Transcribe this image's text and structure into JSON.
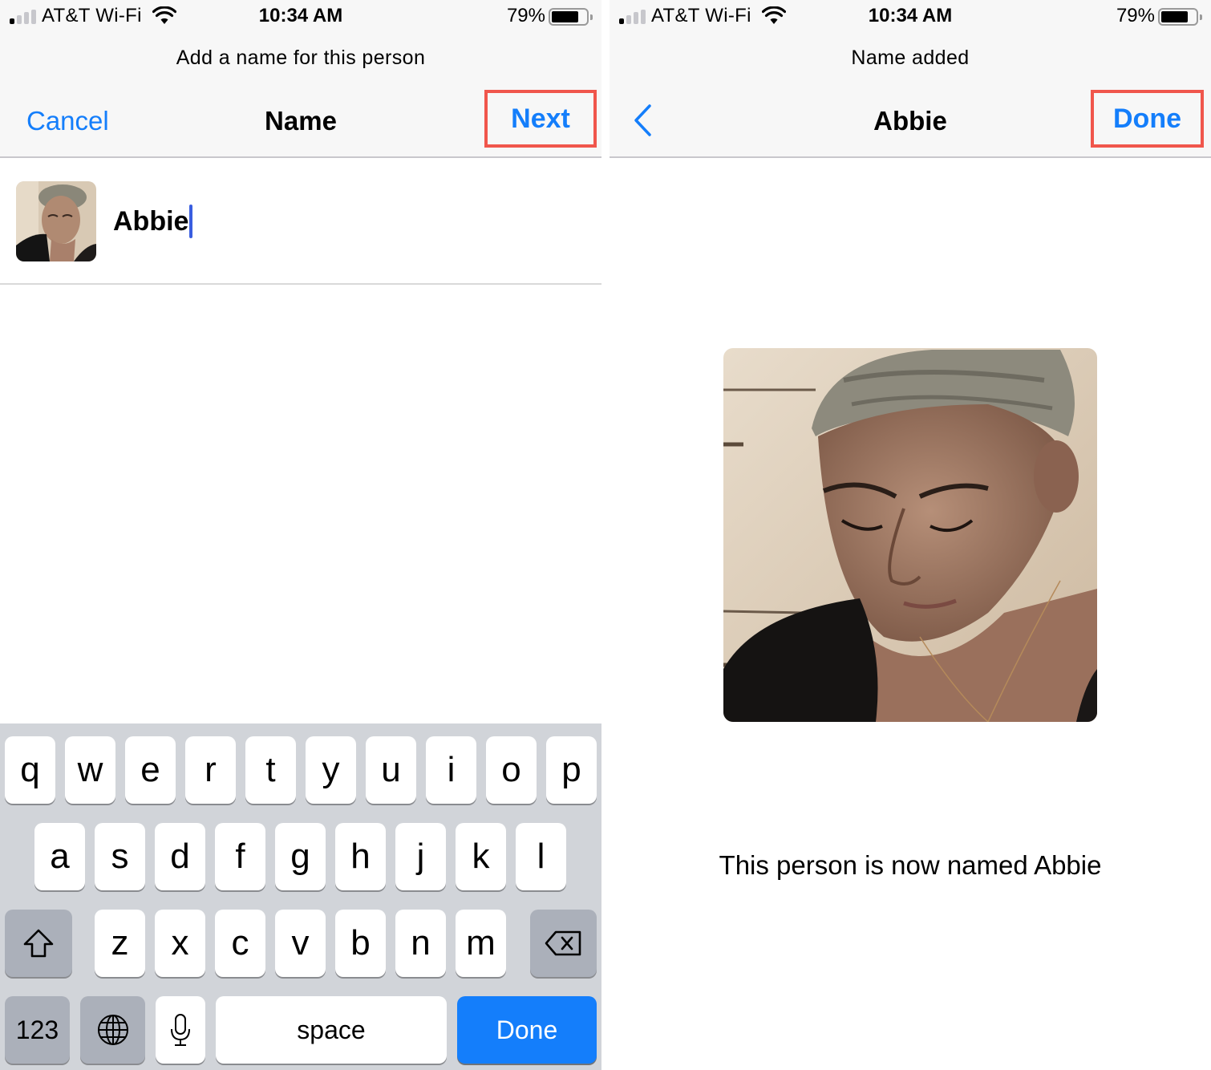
{
  "status_bar": {
    "carrier": "AT&T Wi-Fi",
    "time": "10:34 AM",
    "battery_percent_label": "79%",
    "battery_level": 0.79,
    "signal_bars_active": 1,
    "signal_bars_total": 4,
    "icons": [
      "signal-icon",
      "wifi-icon",
      "battery-icon"
    ]
  },
  "left_screen": {
    "prompt": "Add a name for this person",
    "nav": {
      "left_button": "Cancel",
      "title": "Name",
      "right_button": "Next"
    },
    "name_field": {
      "value": "Abbie"
    },
    "keyboard": {
      "row1": [
        "q",
        "w",
        "e",
        "r",
        "t",
        "y",
        "u",
        "i",
        "o",
        "p"
      ],
      "row2": [
        "a",
        "s",
        "d",
        "f",
        "g",
        "h",
        "j",
        "k",
        "l"
      ],
      "row3": [
        "z",
        "x",
        "c",
        "v",
        "b",
        "n",
        "m"
      ],
      "shift_icon": "shift-icon",
      "delete_icon": "backspace-icon",
      "numbers_label": "123",
      "globe_icon": "globe-icon",
      "mic_icon": "microphone-icon",
      "space_label": "space",
      "done_label": "Done"
    }
  },
  "right_screen": {
    "prompt": "Name added",
    "nav": {
      "back_icon": "chevron-left-icon",
      "title": "Abbie",
      "right_button": "Done"
    },
    "confirmation": "This person is now named Abbie"
  },
  "colors": {
    "accent_blue": "#147efb",
    "highlight_red": "#f0564c",
    "header_bg": "#f7f7f7",
    "keyboard_bg": "#d1d4d9",
    "caret": "#3a5ee0"
  }
}
